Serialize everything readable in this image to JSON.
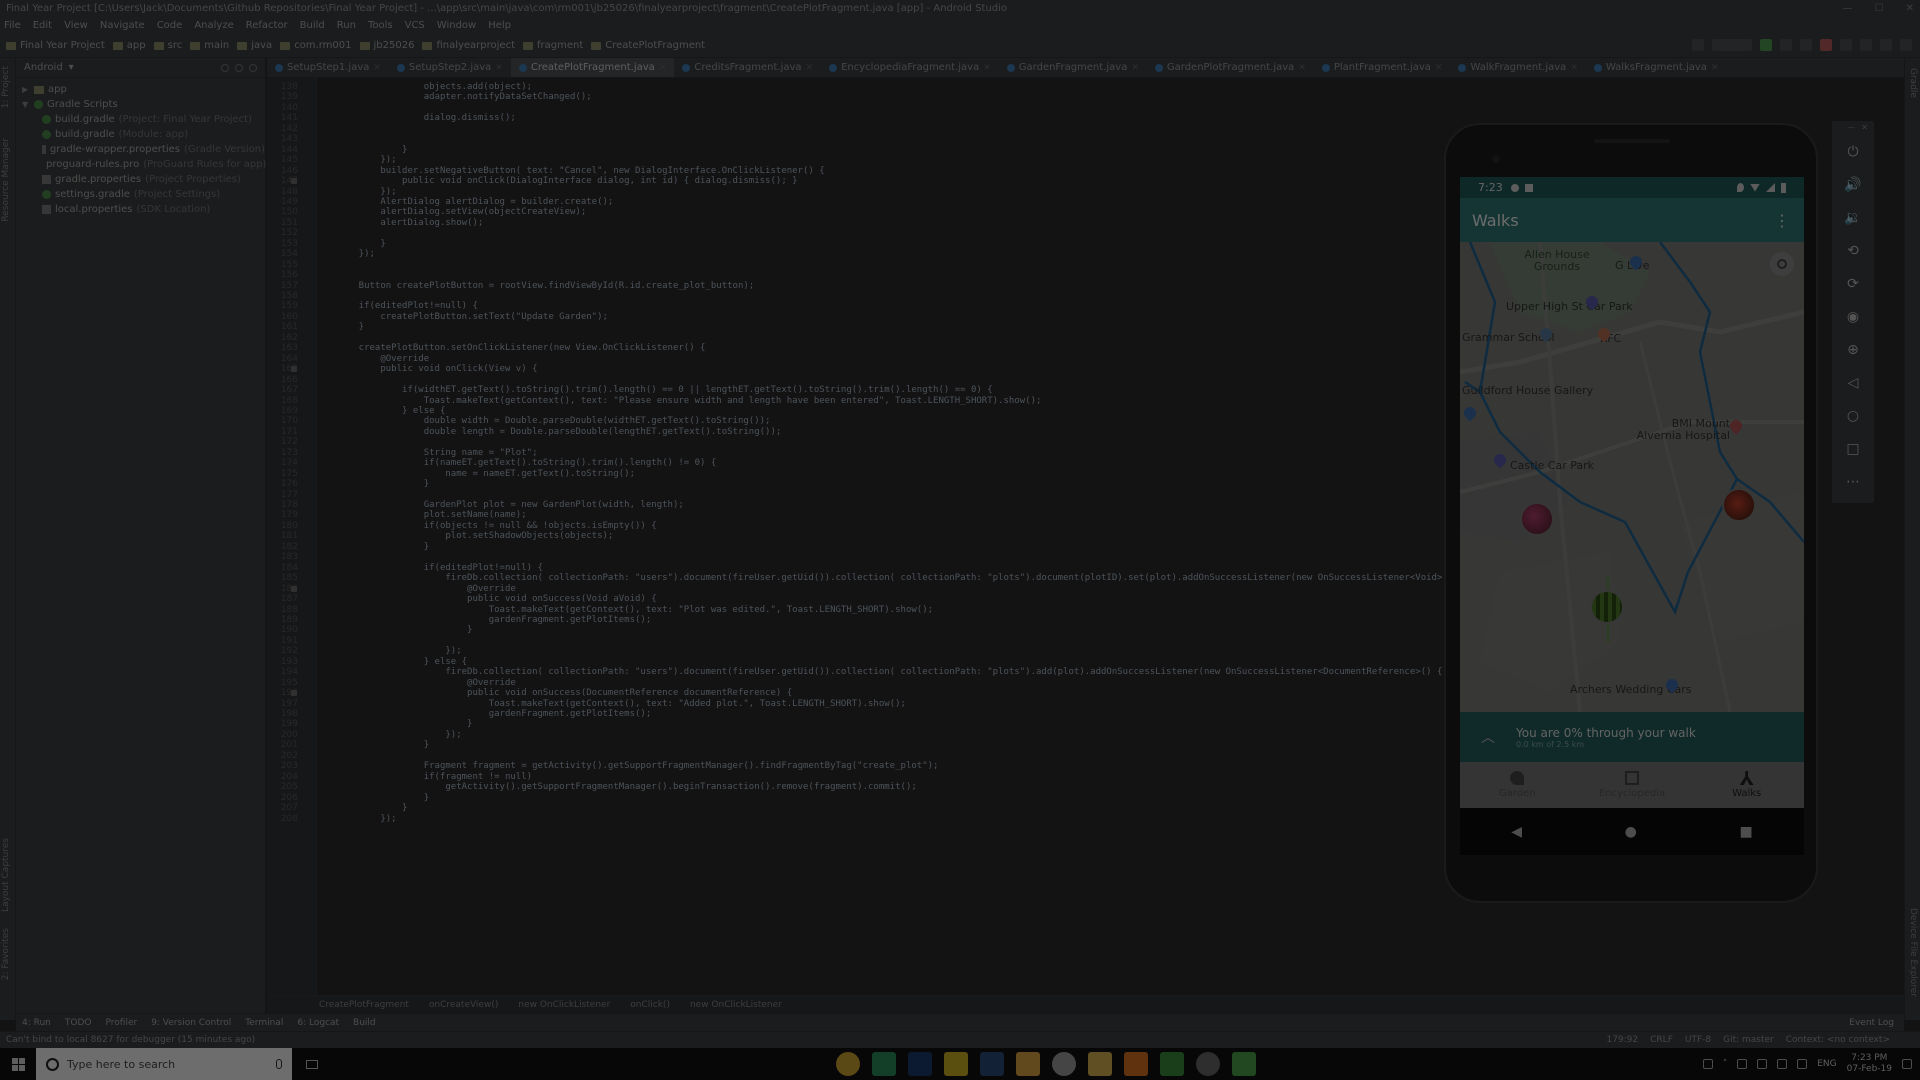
{
  "window": {
    "title": "Final Year Project [C:\\Users\\Jack\\Documents\\Github Repositories\\Final Year Project] - ...\\app\\src\\main\\java\\com\\rm001\\jb25026\\finalyearproject\\fragment\\CreatePlotFragment.java [app] - Android Studio"
  },
  "menu": [
    "File",
    "Edit",
    "View",
    "Navigate",
    "Code",
    "Analyze",
    "Refactor",
    "Build",
    "Run",
    "Tools",
    "VCS",
    "Window",
    "Help"
  ],
  "breadcrumbs": [
    "Final Year Project",
    "app",
    "src",
    "main",
    "java",
    "com.rm001",
    "jb25026",
    "finalyearproject",
    "fragment",
    "CreatePlotFragment"
  ],
  "project_panel": {
    "view": "Android",
    "items": [
      {
        "label": "app",
        "note": "",
        "kind": "folder",
        "indent": 0
      },
      {
        "label": "Gradle Scripts",
        "note": "",
        "kind": "gradle",
        "indent": 0
      },
      {
        "label": "build.gradle",
        "note": "(Project: Final Year Project)",
        "kind": "gradle",
        "indent": 1
      },
      {
        "label": "build.gradle",
        "note": "(Module: app)",
        "kind": "gradle",
        "indent": 1
      },
      {
        "label": "gradle-wrapper.properties",
        "note": "(Gradle Version)",
        "kind": "file",
        "indent": 1
      },
      {
        "label": "proguard-rules.pro",
        "note": "(ProGuard Rules for app)",
        "kind": "file",
        "indent": 1
      },
      {
        "label": "gradle.properties",
        "note": "(Project Properties)",
        "kind": "file",
        "indent": 1
      },
      {
        "label": "settings.gradle",
        "note": "(Project Settings)",
        "kind": "gradle",
        "indent": 1
      },
      {
        "label": "local.properties",
        "note": "(SDK Location)",
        "kind": "file",
        "indent": 1
      }
    ]
  },
  "editor_tabs": [
    {
      "label": "SetupStep1.java",
      "active": false
    },
    {
      "label": "SetupStep2.java",
      "active": false
    },
    {
      "label": "CreatePlotFragment.java",
      "active": true
    },
    {
      "label": "CreditsFragment.java",
      "active": false
    },
    {
      "label": "EncyclopediaFragment.java",
      "active": false
    },
    {
      "label": "GardenFragment.java",
      "active": false
    },
    {
      "label": "GardenPlotFragment.java",
      "active": false
    },
    {
      "label": "PlantFragment.java",
      "active": false
    },
    {
      "label": "WalkFragment.java",
      "active": false
    },
    {
      "label": "WalksFragment.java",
      "active": false
    }
  ],
  "code_lines": [
    "                objects.add(object);",
    "                adapter.notifyDataSetChanged();",
    "",
    "                dialog.dismiss();",
    "",
    "",
    "            }",
    "        });",
    "        builder.setNegativeButton( text: \"Cancel\", new DialogInterface.OnClickListener() {",
    "            public void onClick(DialogInterface dialog, int id) { dialog.dismiss(); }",
    "        });",
    "        AlertDialog alertDialog = builder.create();",
    "        alertDialog.setView(objectCreateView);",
    "        alertDialog.show();",
    "",
    "        }",
    "    });",
    "",
    "",
    "    Button createPlotButton = rootView.findViewById(R.id.create_plot_button);",
    "",
    "    if(editedPlot!=null) {",
    "        createPlotButton.setText(\"Update Garden\");",
    "    }",
    "",
    "    createPlotButton.setOnClickListener(new View.OnClickListener() {",
    "        @Override",
    "        public void onClick(View v) {",
    "",
    "            if(widthET.getText().toString().trim().length() == 0 || lengthET.getText().toString().trim().length() == 0) {",
    "                Toast.makeText(getContext(), text: \"Please ensure width and length have been entered\", Toast.LENGTH_SHORT).show();",
    "            } else {",
    "                double width = Double.parseDouble(widthET.getText().toString());",
    "                double length = Double.parseDouble(lengthET.getText().toString());",
    "",
    "                String name = \"Plot\";",
    "                if(nameET.getText().toString().trim().length() != 0) {",
    "                    name = nameET.getText().toString();",
    "                }",
    "",
    "                GardenPlot plot = new GardenPlot(width, length);",
    "                plot.setName(name);",
    "                if(objects != null && !objects.isEmpty()) {",
    "                    plot.setShadowObjects(objects);",
    "                }",
    "",
    "                if(editedPlot!=null) {",
    "                    fireDb.collection( collectionPath: \"users\").document(fireUser.getUid()).collection( collectionPath: \"plots\").document(plotID).set(plot).addOnSuccessListener(new OnSuccessListener<Void>() {",
    "                        @Override",
    "                        public void onSuccess(Void aVoid) {",
    "                            Toast.makeText(getContext(), text: \"Plot was edited.\", Toast.LENGTH_SHORT).show();",
    "                            gardenFragment.getPlotItems();",
    "                        }",
    "",
    "                    });",
    "                } else {",
    "                    fireDb.collection( collectionPath: \"users\").document(fireUser.getUid()).collection( collectionPath: \"plots\").add(plot).addOnSuccessListener(new OnSuccessListener<DocumentReference>() {",
    "                        @Override",
    "                        public void onSuccess(DocumentReference documentReference) {",
    "                            Toast.makeText(getContext(), text: \"Added plot.\", Toast.LENGTH_SHORT).show();",
    "                            gardenFragment.getPlotItems();",
    "                        }",
    "                    });",
    "                }",
    "",
    "                Fragment fragment = getActivity().getSupportFragmentManager().findFragmentByTag(\"create_plot\");",
    "                if(fragment != null)",
    "                    getActivity().getSupportFragmentManager().beginTransaction().remove(fragment).commit();",
    "                }",
    "            }",
    "        });"
  ],
  "editor_breadcrumbs": [
    "CreatePlotFragment",
    "onCreateView()",
    "new OnClickListener",
    "onClick()",
    "new OnClickListener"
  ],
  "tool_windows": [
    "4: Run",
    "TODO",
    "Profiler",
    "9: Version Control",
    "Terminal",
    "6: Logcat",
    "Build"
  ],
  "event_log": "Event Log",
  "status": {
    "message": "Can't bind to local 8627 for debugger (15 minutes ago)",
    "position": "179:92",
    "line_sep": "CRLF",
    "encoding": "UTF-8",
    "vcs": "Git: master",
    "context": "Context: <no context>"
  },
  "emulator_controls": [
    "power",
    "volume-up",
    "volume-down",
    "rotate-left",
    "rotate-right",
    "camera",
    "zoom",
    "back",
    "home",
    "overview",
    "more"
  ],
  "phone": {
    "time": "7:23",
    "app_title": "Walks",
    "map_labels": [
      {
        "text": "Allen House Grounds"
      },
      {
        "text": "G Live"
      },
      {
        "text": "Upper High St Car Park"
      },
      {
        "text": "Grammar School"
      },
      {
        "text": "KFC"
      },
      {
        "text": "Guildford House Gallery"
      },
      {
        "text": "BMI Mount Alvernia Hospital"
      },
      {
        "text": "Castle Car Park"
      },
      {
        "text": "Archers Wedding Cars"
      }
    ],
    "progress_text": "You are 0% through your walk",
    "progress_subtext": "0.0 km of 2.5 km",
    "progress_fraction": 0,
    "nav_items": [
      {
        "label": "Garden",
        "active": false
      },
      {
        "label": "Encyclopedia",
        "active": false
      },
      {
        "label": "Walks",
        "active": true
      }
    ]
  },
  "taskbar": {
    "search_placeholder": "Type here to search",
    "time": "7:23 PM",
    "date": "07-Feb-19",
    "lang": "ENG"
  },
  "colors": {
    "ide_bg": "#2b2b2b",
    "panel_bg": "#3c3f41",
    "app_primary": "#2e7773",
    "route": "#1f6fb0"
  }
}
